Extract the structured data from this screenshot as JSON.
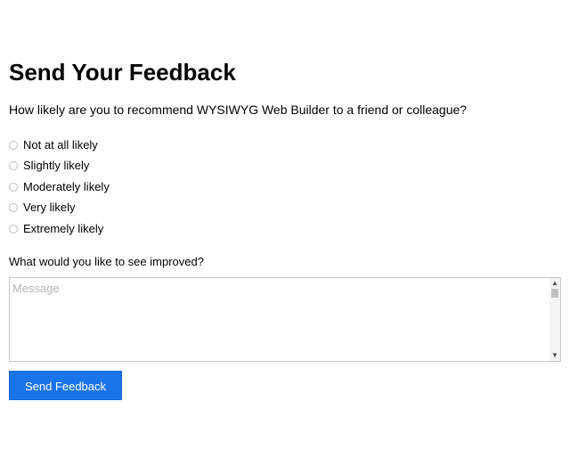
{
  "form": {
    "title": "Send Your Feedback",
    "question": "How likely are you to recommend WYSIWYG Web Builder to a friend or colleague?",
    "options": [
      {
        "label": "Not at all likely",
        "selected": false
      },
      {
        "label": "Slightly likely",
        "selected": false
      },
      {
        "label": "Moderately likely",
        "selected": false
      },
      {
        "label": "Very likely",
        "selected": false
      },
      {
        "label": "Extremely likely",
        "selected": false
      }
    ],
    "improve_label": "What would you like to see improved?",
    "message_placeholder": "Message",
    "message_value": "",
    "submit_label": "Send Feedback"
  },
  "colors": {
    "button_background": "#1a73e8",
    "button_text": "#ffffff",
    "placeholder_text": "#b4b4b4"
  },
  "icons": {
    "scroll_up": "chevron-up-icon",
    "scroll_down": "chevron-down-icon"
  }
}
